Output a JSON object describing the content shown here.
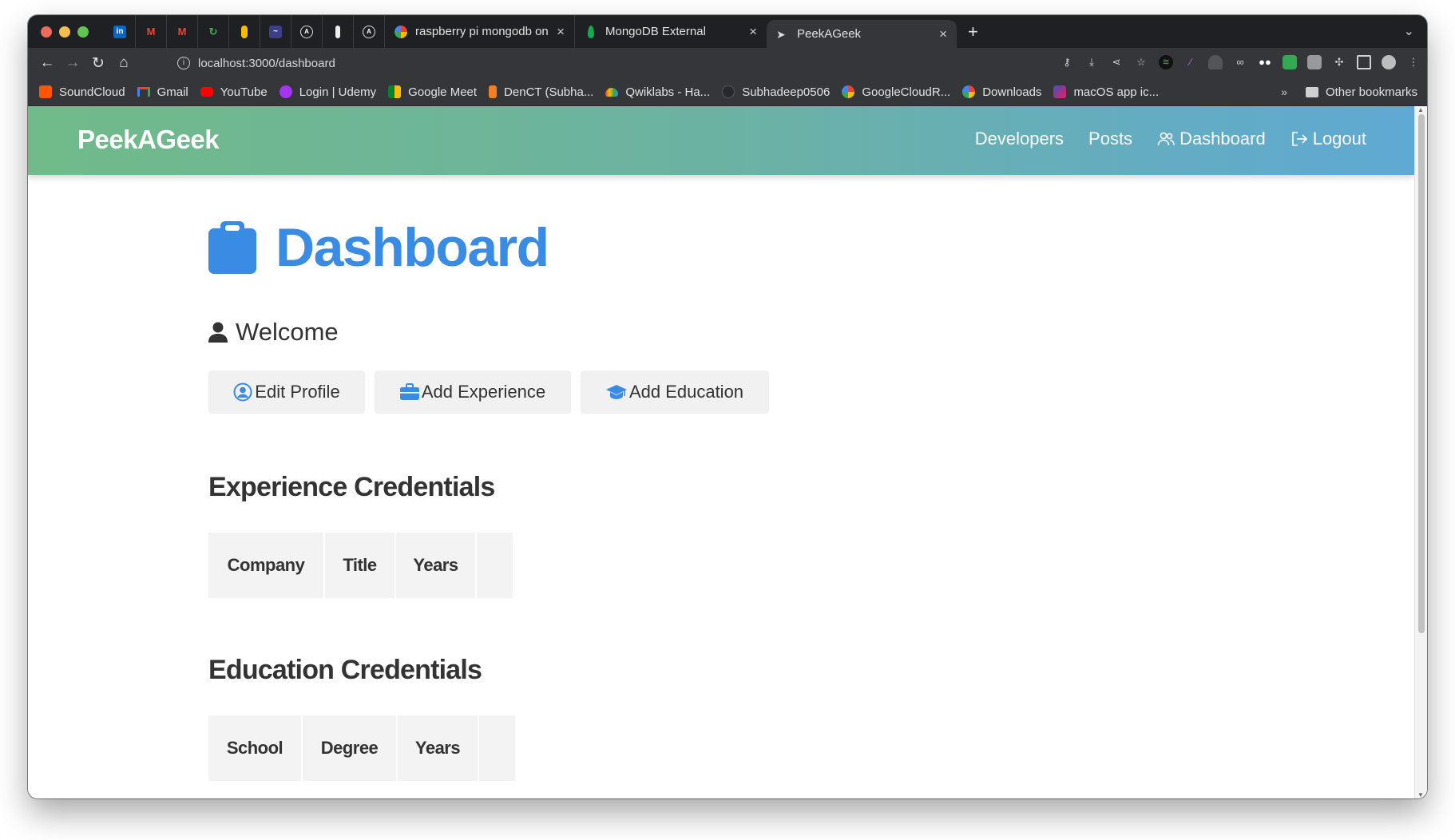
{
  "browser": {
    "tabs": [
      {
        "title": "raspberry pi mongodb on",
        "favicon": "google-icon"
      },
      {
        "title": "MongoDB External",
        "favicon": "mongodb-leaf-icon"
      },
      {
        "title": "PeekAGeek",
        "favicon": "paper-plane-icon"
      }
    ],
    "new_tab": "+",
    "tab_close": "×",
    "url": "localhost:3000/dashboard"
  },
  "bookmarks": {
    "items": [
      {
        "label": "SoundCloud",
        "color": "#ff5500"
      },
      {
        "label": "Gmail",
        "color": "#ea4335"
      },
      {
        "label": "YouTube",
        "color": "#ff0000"
      },
      {
        "label": "Login | Udemy",
        "color": "#a435f0"
      },
      {
        "label": "Google Meet",
        "color": "#00897b"
      },
      {
        "label": "DenCT (Subha...",
        "color": "#f48024"
      },
      {
        "label": "Qwiklabs - Ha...",
        "color": "#4285f4"
      },
      {
        "label": "Subhadeep0506",
        "color": "#24292e"
      },
      {
        "label": "GoogleCloudR...",
        "color": "#4285f4"
      },
      {
        "label": "Downloads",
        "color": "#4285f4"
      },
      {
        "label": "macOS app ic...",
        "color": "#c2185b"
      }
    ],
    "more": "»",
    "other": "Other bookmarks"
  },
  "navbar": {
    "brand": "PeekAGeek",
    "links": {
      "developers": "Developers",
      "posts": "Posts",
      "dashboard": "Dashboard",
      "logout": "Logout"
    }
  },
  "main": {
    "title": "Dashboard",
    "welcome": "Welcome",
    "buttons": {
      "edit_profile": "Edit Profile",
      "add_experience": "Add Experience",
      "add_education": "Add Education"
    },
    "experience": {
      "heading": "Experience Credentials",
      "columns": [
        "Company",
        "Title",
        "Years",
        ""
      ]
    },
    "education": {
      "heading": "Education Credentials",
      "columns": [
        "School",
        "Degree",
        "Years",
        ""
      ]
    }
  },
  "colors": {
    "accent": "#3a8be3",
    "navbar_start": "#71ba89",
    "navbar_end": "#5fa9d4",
    "button_bg": "#f1f1f1",
    "table_header_bg": "#f3f3f3",
    "text": "#333333"
  }
}
